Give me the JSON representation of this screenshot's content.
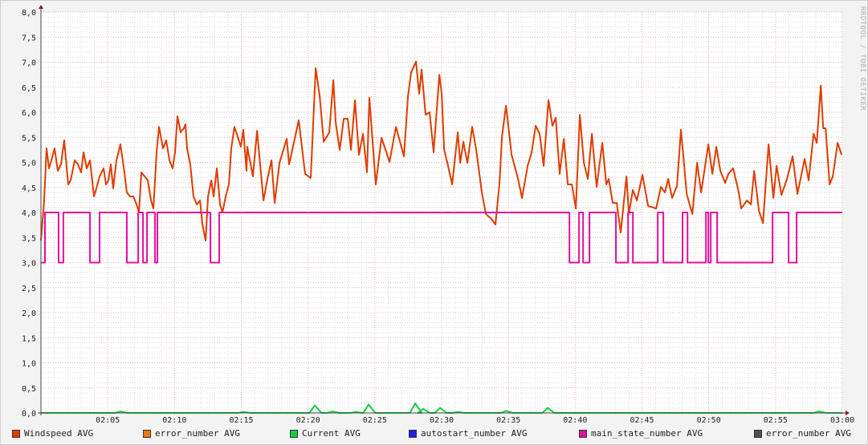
{
  "watermark": "RRDTOOL / TOBI OETIKER",
  "chart_data": {
    "type": "line",
    "title": "",
    "xlabel": "",
    "ylabel": "",
    "ylim": [
      0,
      8
    ],
    "xlim_minutes": [
      0,
      60
    ],
    "grid": true,
    "y_ticks": [
      "0,0",
      "0,5",
      "1,0",
      "1,5",
      "2,0",
      "2,5",
      "3,0",
      "3,5",
      "4,0",
      "4,5",
      "5,0",
      "5,5",
      "6,0",
      "6,5",
      "7,0",
      "7,5",
      "8,0"
    ],
    "x_ticks": [
      "02:05",
      "02:10",
      "02:15",
      "02:20",
      "02:25",
      "02:30",
      "02:35",
      "02:40",
      "02:45",
      "02:50",
      "02:55",
      "03:00"
    ],
    "legend_placement": "bottom",
    "legend": [
      {
        "name": "Windspeed AVG",
        "color": "#e03c00"
      },
      {
        "name": "error_number AVG",
        "color": "#e87a10"
      },
      {
        "name": "Current AVG",
        "color": "#10d040"
      },
      {
        "name": "autostart_number AVG",
        "color": "#2020e8"
      },
      {
        "name": "main_state_number AVG",
        "color": "#e010a0"
      },
      {
        "name": "error_number AVG",
        "color": "#505050"
      }
    ],
    "series": [
      {
        "name": "Windspeed AVG",
        "color": "#e03c00",
        "x_unit": "minutes after 02:00",
        "points": [
          [
            0,
            3.44
          ],
          [
            0.24,
            4.24
          ],
          [
            0.42,
            5.28
          ],
          [
            0.6,
            4.88
          ],
          [
            0.78,
            5.04
          ],
          [
            1.02,
            5.28
          ],
          [
            1.26,
            4.83
          ],
          [
            1.5,
            4.96
          ],
          [
            1.74,
            5.44
          ],
          [
            2.04,
            4.56
          ],
          [
            2.22,
            4.64
          ],
          [
            2.53,
            5.04
          ],
          [
            2.77,
            4.96
          ],
          [
            3.01,
            4.8
          ],
          [
            3.19,
            5.2
          ],
          [
            3.43,
            4.88
          ],
          [
            3.67,
            5.04
          ],
          [
            3.97,
            4.32
          ],
          [
            4.15,
            4.48
          ],
          [
            4.39,
            4.72
          ],
          [
            4.69,
            4.88
          ],
          [
            4.87,
            4.56
          ],
          [
            5.05,
            4.64
          ],
          [
            5.23,
            4.96
          ],
          [
            5.41,
            4.48
          ],
          [
            5.65,
            5.04
          ],
          [
            5.95,
            5.36
          ],
          [
            6.25,
            4.8
          ],
          [
            6.43,
            4.4
          ],
          [
            6.67,
            4.32
          ],
          [
            6.92,
            4.32
          ],
          [
            7.16,
            4.16
          ],
          [
            7.34,
            4.0
          ],
          [
            7.52,
            4.8
          ],
          [
            7.76,
            4.72
          ],
          [
            8.0,
            4.64
          ],
          [
            8.24,
            4.24
          ],
          [
            8.42,
            4.08
          ],
          [
            8.66,
            5.2
          ],
          [
            8.84,
            5.71
          ],
          [
            9.14,
            5.28
          ],
          [
            9.38,
            5.44
          ],
          [
            9.62,
            5.04
          ],
          [
            9.86,
            4.88
          ],
          [
            10.04,
            5.2
          ],
          [
            10.22,
            5.92
          ],
          [
            10.46,
            5.6
          ],
          [
            10.7,
            5.68
          ],
          [
            10.82,
            5.76
          ],
          [
            10.94,
            5.28
          ],
          [
            11.18,
            4.96
          ],
          [
            11.42,
            4.32
          ],
          [
            11.67,
            4.16
          ],
          [
            11.91,
            4.24
          ],
          [
            12.09,
            3.76
          ],
          [
            12.33,
            3.44
          ],
          [
            12.51,
            4.32
          ],
          [
            12.75,
            4.64
          ],
          [
            12.93,
            4.32
          ],
          [
            13.17,
            4.88
          ],
          [
            13.41,
            4.16
          ],
          [
            13.59,
            4.0
          ],
          [
            13.83,
            4.32
          ],
          [
            14.07,
            4.56
          ],
          [
            14.25,
            5.28
          ],
          [
            14.49,
            5.71
          ],
          [
            14.97,
            5.31
          ],
          [
            15.15,
            5.65
          ],
          [
            15.39,
            4.83
          ],
          [
            15.45,
            5.31
          ],
          [
            15.87,
            4.72
          ],
          [
            16.18,
            5.63
          ],
          [
            16.66,
            4.24
          ],
          [
            16.96,
            4.67
          ],
          [
            17.26,
            5.04
          ],
          [
            17.5,
            4.19
          ],
          [
            17.86,
            4.99
          ],
          [
            18.4,
            5.47
          ],
          [
            18.58,
            4.96
          ],
          [
            19.0,
            5.47
          ],
          [
            19.3,
            5.84
          ],
          [
            19.78,
            4.77
          ],
          [
            20.2,
            4.69
          ],
          [
            20.57,
            6.88
          ],
          [
            20.87,
            6.32
          ],
          [
            21.17,
            5.41
          ],
          [
            21.59,
            5.6
          ],
          [
            21.89,
            6.64
          ],
          [
            22.07,
            5.79
          ],
          [
            22.37,
            5.25
          ],
          [
            22.67,
            5.87
          ],
          [
            22.97,
            5.87
          ],
          [
            23.21,
            5.25
          ],
          [
            23.51,
            6.24
          ],
          [
            23.81,
            5.15
          ],
          [
            24.11,
            5.57
          ],
          [
            24.41,
            4.8
          ],
          [
            24.59,
            6.29
          ],
          [
            25.01,
            4.77
          ],
          [
            25.07,
            4.56
          ],
          [
            25.5,
            5.49
          ],
          [
            25.8,
            5.25
          ],
          [
            26.1,
            5.01
          ],
          [
            26.58,
            5.71
          ],
          [
            27.18,
            5.12
          ],
          [
            27.48,
            6.32
          ],
          [
            27.72,
            6.8
          ],
          [
            28.08,
            7.01
          ],
          [
            28.32,
            6.37
          ],
          [
            28.5,
            6.85
          ],
          [
            28.8,
            5.95
          ],
          [
            29.1,
            6.0
          ],
          [
            29.4,
            5.2
          ],
          [
            29.83,
            6.75
          ],
          [
            30.01,
            6.35
          ],
          [
            30.19,
            5.25
          ],
          [
            30.43,
            4.99
          ],
          [
            30.79,
            4.56
          ],
          [
            31.21,
            5.6
          ],
          [
            31.39,
            4.99
          ],
          [
            31.63,
            5.41
          ],
          [
            31.93,
            4.99
          ],
          [
            32.29,
            5.71
          ],
          [
            32.59,
            5.25
          ],
          [
            33.01,
            4.4
          ],
          [
            33.31,
            3.97
          ],
          [
            33.73,
            3.87
          ],
          [
            34.03,
            3.76
          ],
          [
            34.34,
            4.61
          ],
          [
            34.52,
            5.52
          ],
          [
            34.82,
            6.13
          ],
          [
            35.24,
            5.15
          ],
          [
            35.72,
            4.67
          ],
          [
            36.02,
            4.29
          ],
          [
            36.44,
            4.93
          ],
          [
            36.74,
            5.2
          ],
          [
            37.04,
            5.73
          ],
          [
            37.34,
            5.57
          ],
          [
            37.64,
            4.93
          ],
          [
            38.0,
            6.24
          ],
          [
            38.3,
            5.73
          ],
          [
            38.54,
            5.89
          ],
          [
            38.84,
            4.77
          ],
          [
            39.15,
            5.47
          ],
          [
            39.45,
            4.56
          ],
          [
            39.75,
            4.56
          ],
          [
            40.05,
            4.08
          ],
          [
            40.35,
            5.95
          ],
          [
            40.65,
            4.99
          ],
          [
            40.95,
            4.67
          ],
          [
            41.25,
            5.57
          ],
          [
            41.61,
            4.51
          ],
          [
            42.03,
            5.39
          ],
          [
            42.33,
            4.56
          ],
          [
            42.51,
            4.67
          ],
          [
            42.81,
            4.19
          ],
          [
            43.11,
            4.19
          ],
          [
            43.41,
            3.6
          ],
          [
            43.84,
            4.72
          ],
          [
            44.02,
            3.97
          ],
          [
            44.32,
            4.45
          ],
          [
            44.62,
            4.24
          ],
          [
            45.04,
            4.75
          ],
          [
            45.46,
            4.13
          ],
          [
            46.06,
            4.08
          ],
          [
            46.42,
            4.51
          ],
          [
            46.72,
            4.4
          ],
          [
            46.96,
            4.67
          ],
          [
            47.26,
            4.29
          ],
          [
            47.62,
            4.53
          ],
          [
            47.92,
            5.65
          ],
          [
            48.35,
            4.37
          ],
          [
            48.77,
            3.97
          ],
          [
            49.13,
            4.99
          ],
          [
            49.43,
            4.4
          ],
          [
            49.97,
            5.36
          ],
          [
            50.27,
            4.77
          ],
          [
            50.57,
            5.31
          ],
          [
            50.87,
            4.83
          ],
          [
            51.23,
            4.59
          ],
          [
            51.47,
            4.77
          ],
          [
            51.83,
            4.88
          ],
          [
            52.25,
            4.4
          ],
          [
            52.43,
            4.08
          ],
          [
            52.86,
            4.24
          ],
          [
            53.16,
            4.16
          ],
          [
            53.4,
            4.83
          ],
          [
            53.76,
            4.03
          ],
          [
            54.06,
            3.79
          ],
          [
            54.48,
            5.36
          ],
          [
            54.84,
            4.29
          ],
          [
            55.08,
            4.93
          ],
          [
            55.44,
            4.35
          ],
          [
            55.86,
            4.67
          ],
          [
            56.28,
            5.12
          ],
          [
            56.64,
            4.37
          ],
          [
            57.18,
            5.07
          ],
          [
            57.48,
            4.64
          ],
          [
            57.85,
            5.57
          ],
          [
            58.09,
            5.39
          ],
          [
            58.39,
            6.53
          ],
          [
            58.57,
            5.68
          ],
          [
            58.75,
            5.68
          ],
          [
            59.05,
            4.56
          ],
          [
            59.29,
            4.72
          ],
          [
            59.65,
            5.39
          ],
          [
            59.95,
            5.15
          ]
        ]
      },
      {
        "name": "main_state_number AVG",
        "color": "#e010a0",
        "step": true,
        "points": [
          [
            0,
            3
          ],
          [
            0.3,
            4
          ],
          [
            1.32,
            3
          ],
          [
            1.68,
            4
          ],
          [
            3.67,
            3
          ],
          [
            4.39,
            4
          ],
          [
            6.43,
            3
          ],
          [
            7.28,
            4
          ],
          [
            7.64,
            3
          ],
          [
            7.94,
            4
          ],
          [
            8.54,
            3
          ],
          [
            8.72,
            4
          ],
          [
            12.69,
            3
          ],
          [
            13.35,
            4
          ],
          [
            39.57,
            3
          ],
          [
            40.29,
            4
          ],
          [
            40.59,
            3
          ],
          [
            41.07,
            4
          ],
          [
            43.05,
            3
          ],
          [
            43.96,
            4
          ],
          [
            44.32,
            3
          ],
          [
            46.18,
            4
          ],
          [
            46.6,
            3
          ],
          [
            48.04,
            4
          ],
          [
            48.41,
            3
          ],
          [
            49.79,
            4
          ],
          [
            49.97,
            3
          ],
          [
            50.15,
            4
          ],
          [
            50.63,
            3
          ],
          [
            54.78,
            4
          ],
          [
            55.98,
            3
          ],
          [
            56.58,
            4
          ],
          [
            60,
            4
          ]
        ]
      },
      {
        "name": "Current AVG",
        "color": "#10d040",
        "bumps": true,
        "points": [
          [
            5.95,
            0.03
          ],
          [
            15.15,
            0.02
          ],
          [
            20.5,
            0.15
          ],
          [
            21.83,
            0.03
          ],
          [
            23.57,
            0.02
          ],
          [
            24.53,
            0.17
          ],
          [
            28.02,
            0.19
          ],
          [
            28.62,
            0.08
          ],
          [
            29.89,
            0.1
          ],
          [
            31.21,
            0.02
          ],
          [
            34.82,
            0.04
          ],
          [
            37.94,
            0.1
          ],
          [
            58.27,
            0.03
          ]
        ]
      }
    ]
  }
}
